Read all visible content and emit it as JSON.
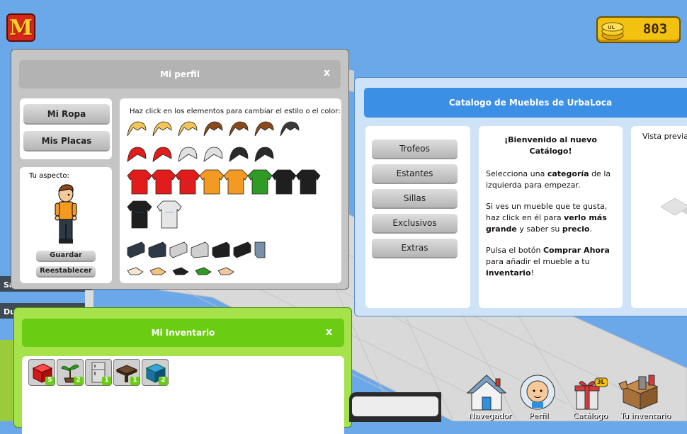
{
  "app": {
    "logo_letter": "M",
    "coins": "803"
  },
  "room_menu": {
    "item_1": "Sa",
    "item_2": "Du"
  },
  "profile": {
    "title": "Mi perfil",
    "close": "x",
    "tab_clothes": "Mi Ropa",
    "tab_badges": "Mis Placas",
    "clothes_hint": "Haz click en los elementos para cambiar el estilo o el color:",
    "look_label": "Tu aspecto:",
    "save_button": "Guardar",
    "reset_button": "Reestablecer"
  },
  "catalog": {
    "title": "Catalogo de Muebles de UrbaLoca",
    "categories": [
      "Trofeos",
      "Estantes",
      "Sillas",
      "Exclusivos",
      "Extras"
    ],
    "welcome_heading": "¡Bienvenido al nuevo Catálogo!",
    "p1_a": "Selecciona una ",
    "p1_b": "categoría",
    "p1_c": " de la izquierda para empezar.",
    "p2_a": "Si ves un mueble que te gusta, haz click en él para ",
    "p2_b": "verlo más grande",
    "p2_c": " y saber su ",
    "p2_d": "precio",
    "p2_e": ".",
    "p3_a": "Pulsa el botón ",
    "p3_b": "Comprar Ahora",
    "p3_c": " para añadir el mueble a tu ",
    "p3_d": "inventario",
    "p3_e": "!",
    "preview_label": "Vista previa d"
  },
  "inventory": {
    "title": "Mi Inventario",
    "close": "x",
    "items": [
      {
        "icon": "red-cube-icon",
        "count": "5"
      },
      {
        "icon": "plant-icon",
        "count": "2"
      },
      {
        "icon": "fridge-icon",
        "count": "1"
      },
      {
        "icon": "table-icon",
        "count": "1"
      },
      {
        "icon": "blue-cube-icon",
        "count": "2"
      }
    ]
  },
  "dock": {
    "navigator": "Navegador",
    "profile": "Perfil",
    "catalog": "Catálogo",
    "catalog_badge": "3L",
    "inventory": "Tu inventario"
  },
  "colors": {
    "sky": "#6aa8ea",
    "catalog_accent": "#3b8fe4",
    "inventory_accent": "#6bcd13",
    "profile_gray": "#b3b3b3",
    "coins": "#f3c10f"
  }
}
